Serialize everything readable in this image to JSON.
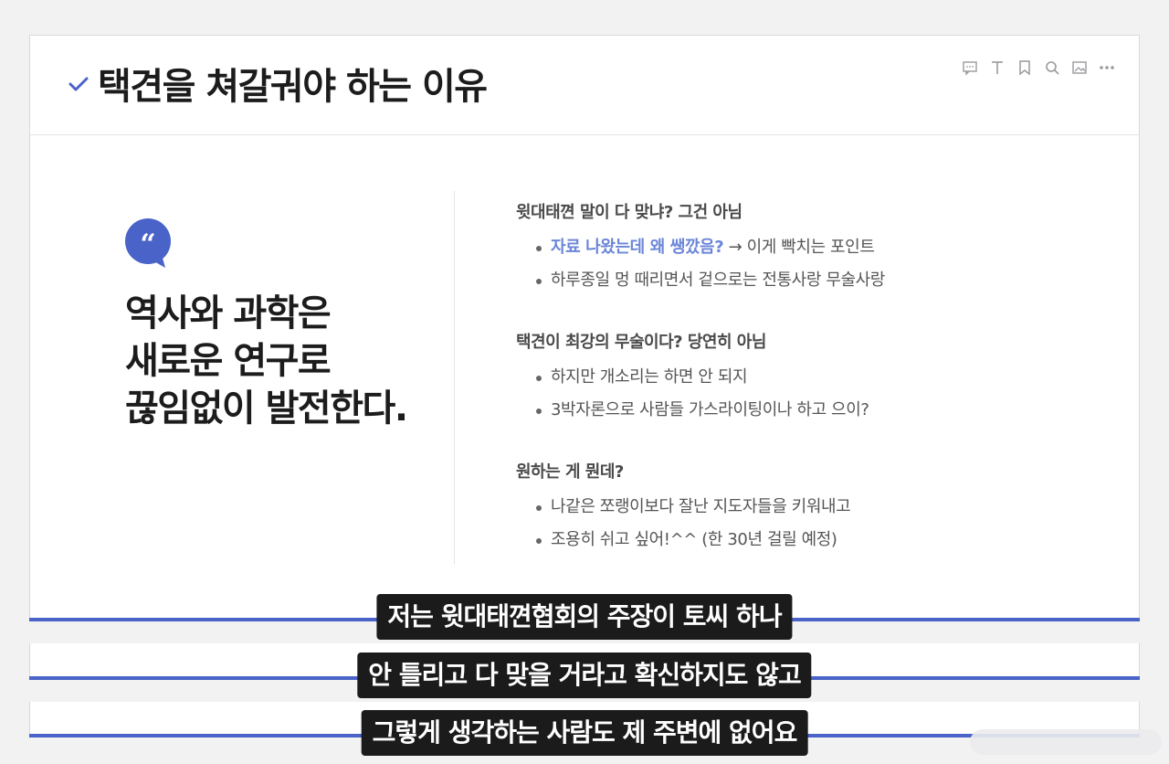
{
  "header": {
    "title": "택견을 쳐갈궈야 하는 이유",
    "check_color": "#4a63c8"
  },
  "toolbar": {
    "icons": [
      "comment-icon",
      "text-icon",
      "bookmark-icon",
      "search-icon",
      "image-icon",
      "more-icon"
    ]
  },
  "quote": {
    "badge_color": "#4a63c8",
    "badge_glyph": "“",
    "lines": [
      "역사와 과학은",
      "새로운 연구로",
      "끊임없이 발전한다."
    ]
  },
  "sections": [
    {
      "title": "윗대태껸 말이 다 맞냐? 그건 아님",
      "items": [
        {
          "link": "자료 나왔는데 왜 쌩깠음?",
          "text": " → 이게 빡치는 포인트"
        },
        {
          "text": "하루종일 멍 때리면서 겉으로는 전통사랑 무술사랑"
        }
      ]
    },
    {
      "title": "택견이 최강의 무술이다? 당연히 아님",
      "items": [
        {
          "text": "하지만 개소리는 하면 안 되지"
        },
        {
          "text": "3박자론으로 사람들 가스라이팅이나 하고 으이?"
        }
      ]
    },
    {
      "title": "원하는 게 뭔데?",
      "items": [
        {
          "text": "나같은 쪼랭이보다 잘난 지도자들을 키워내고"
        },
        {
          "text": "조용히 쉬고 싶어!^^ (한 30년 걸릴 예정)"
        }
      ]
    }
  ],
  "captions": [
    "저는 윗대태껸협회의 주장이 토씨 하나",
    "안 틀리고 다 맞을 거라고 확신하지도 않고",
    "그렇게 생각하는 사람도 제 주변에 없어요"
  ],
  "colors": {
    "accent": "#4a63c8",
    "link": "#6b86d8",
    "caption_bg": "#1b1b1b"
  }
}
